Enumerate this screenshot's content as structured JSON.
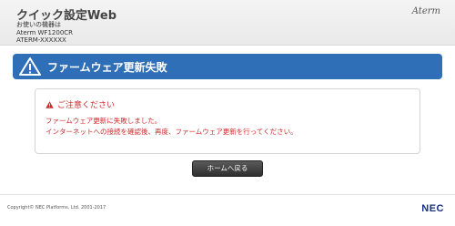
{
  "header": {
    "title": "クイック設定Web",
    "device_label": "お使いの機器は",
    "model": "Aterm WF1200CR",
    "serial": "ATERM-XXXXXX",
    "brand": "Aterm"
  },
  "banner": {
    "title": "ファームウェア更新失敗",
    "icon": "warning-icon",
    "color": "#2f6fb7"
  },
  "notice": {
    "heading": "ご注意ください",
    "lines": [
      "ファームウェア更新に失敗しました。",
      "インターネットへの接続を確認後、再度、ファームウェア更新を行ってください。"
    ],
    "text_color": "#d22b2b"
  },
  "actions": {
    "home_label": "ホームへ戻る"
  },
  "footer": {
    "copyright": "Copyright© NEC Platforms, Ltd. 2001-2017",
    "logo": "NEC"
  }
}
